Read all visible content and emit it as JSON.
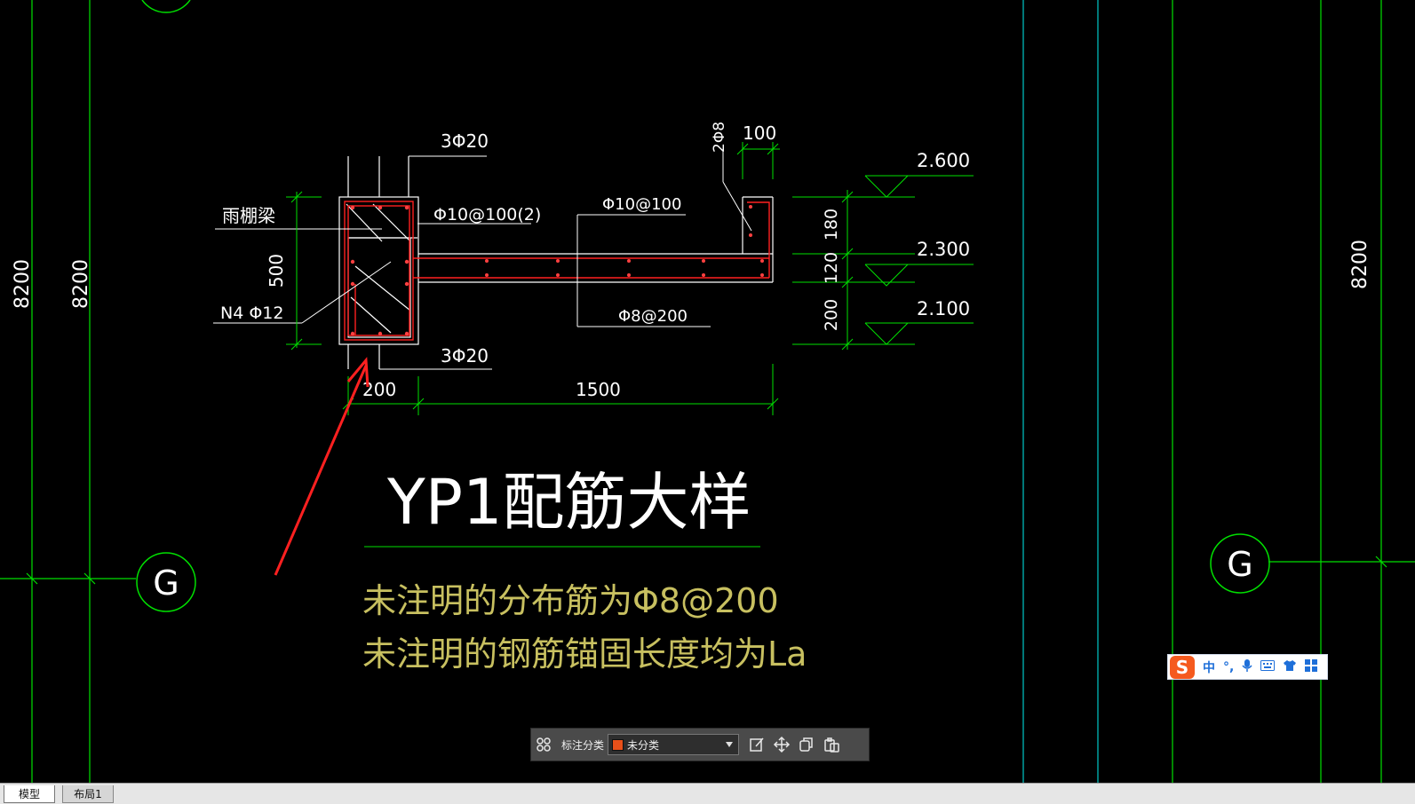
{
  "drawing": {
    "labels": {
      "top_bars": "3Φ20",
      "bottom_bars": "3Φ20",
      "beam_name": "雨棚梁",
      "stirrup": "Φ10@100(2)",
      "slab_top": "Φ10@100",
      "slab_bottom": "Φ8@200",
      "waist_bars": "N4 Φ12",
      "edge_bars": "2Φ8",
      "dim_100": "100",
      "dim_500": "500",
      "dim_200_bottom": "200",
      "dim_1500": "1500",
      "dim_180": "180",
      "dim_120": "120",
      "dim_200_right": "200",
      "elev_1": "2.600",
      "elev_2": "2.300",
      "elev_3": "2.100",
      "axis_dim_left_1": "8200",
      "axis_dim_left_2": "8200",
      "axis_dim_right": "8200",
      "axis_bubble_left": "G",
      "axis_bubble_right": "G"
    },
    "title": "YP1配筋大样",
    "notes": [
      "未注明的分布筋为Φ8@200",
      "未注明的钢筋锚固长度均为La"
    ]
  },
  "annotation_toolbar": {
    "label": "标注分类",
    "selected": "未分类",
    "swatch_color": "#e8501a",
    "icons": [
      "grid-icon",
      "edit-icon",
      "move-icon",
      "copy-icon",
      "paste-icon"
    ]
  },
  "ime_bar": {
    "logo": "S",
    "mode": "中",
    "items": [
      "punctuation-icon",
      "microphone-icon",
      "keyboard-icon",
      "skin-icon",
      "toolbox-icon"
    ]
  },
  "tabs": [
    {
      "label": "模型",
      "active": true
    },
    {
      "label": "布局1",
      "active": false
    }
  ],
  "colors": {
    "background": "#000000",
    "axis_line": "#00ff00",
    "cyan_line": "#00c8c8",
    "drawing_white": "#ffffff",
    "rebar_red": "#ff2020",
    "note_text": "#c8c060",
    "arrow": "#ff2020"
  }
}
